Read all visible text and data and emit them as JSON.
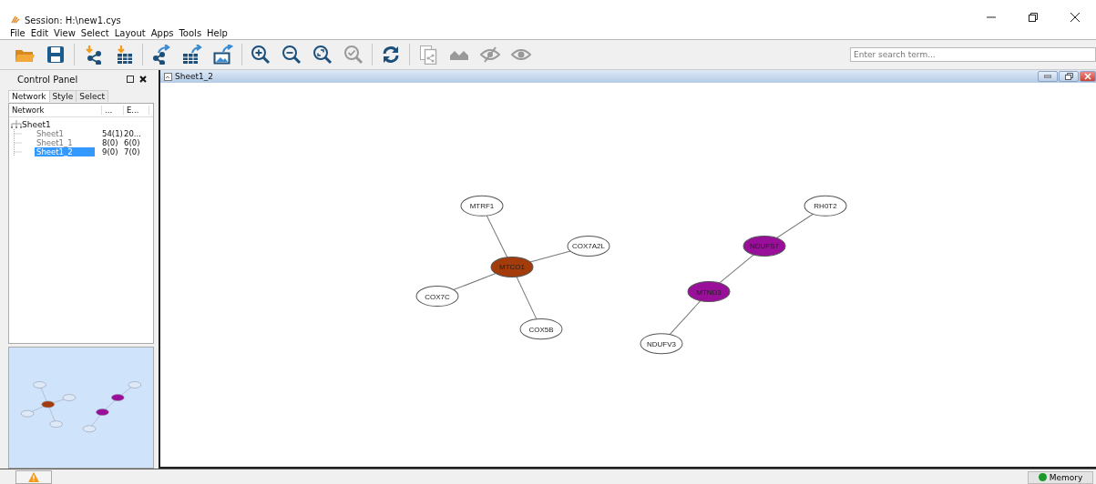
{
  "window": {
    "title": "Session: H:\\new1.cys"
  },
  "menu": [
    "File",
    "Edit",
    "View",
    "Select",
    "Layout",
    "Apps",
    "Tools",
    "Help"
  ],
  "search": {
    "placeholder": "Enter search term..."
  },
  "control_panel": {
    "title": "Control Panel",
    "tabs": [
      {
        "label": "Network",
        "selected": true
      },
      {
        "label": "Style",
        "selected": false
      },
      {
        "label": "Select",
        "selected": false
      }
    ],
    "table": {
      "columns": [
        "Network",
        "...",
        "E..."
      ],
      "tree": [
        {
          "name": "Sheet1",
          "children": [
            {
              "name": "Sheet1",
              "nodes": "54(1)",
              "edges": "20...",
              "selected": false
            },
            {
              "name": "Sheet1_1",
              "nodes": "8(0)",
              "edges": "6(0)",
              "selected": false
            },
            {
              "name": "Sheet1_2",
              "nodes": "9(0)",
              "edges": "7(0)",
              "selected": true
            }
          ]
        }
      ]
    }
  },
  "view": {
    "title": "Sheet1_2",
    "nodes": [
      {
        "label": "MTRF1",
        "color": "#ffffff"
      },
      {
        "label": "COX7A2L",
        "color": "#ffffff"
      },
      {
        "label": "MTCO1",
        "color": "#a33b0b"
      },
      {
        "label": "COX7C",
        "color": "#ffffff"
      },
      {
        "label": "COX5B",
        "color": "#ffffff"
      },
      {
        "label": "RH0T2",
        "color": "#ffffff"
      },
      {
        "label": "NDUFS7",
        "color": "#9a0f9a"
      },
      {
        "label": "MTND3",
        "color": "#9a0f9a"
      },
      {
        "label": "NDUFV3",
        "color": "#ffffff"
      }
    ]
  },
  "status_bar": {
    "memory": "Memory"
  }
}
